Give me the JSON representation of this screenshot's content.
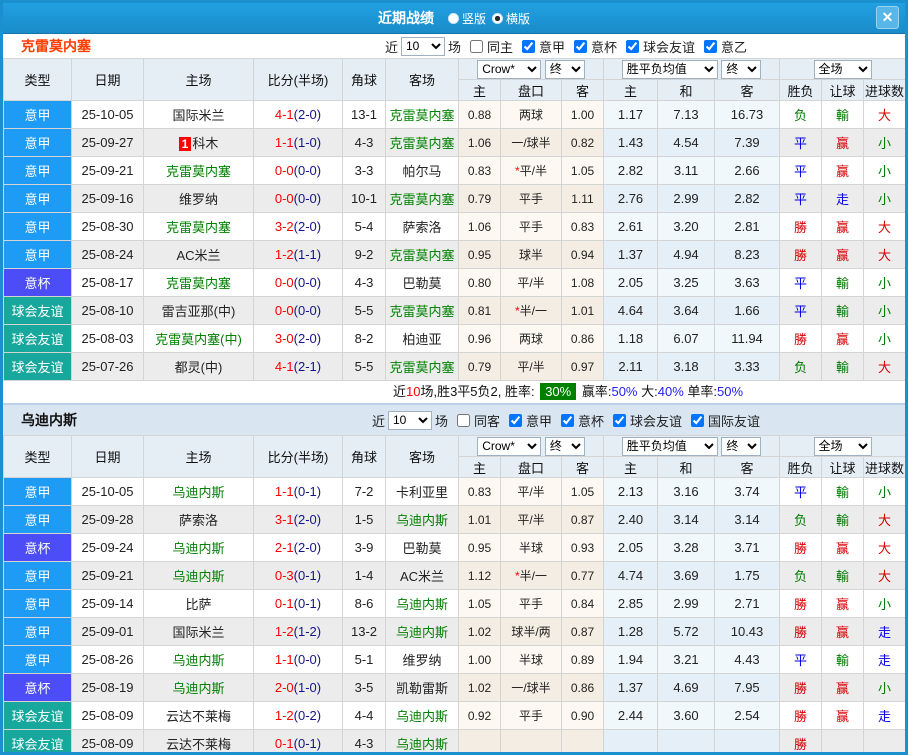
{
  "title_bar": {
    "title": "近期战绩",
    "view_options": [
      {
        "label": "竖版",
        "selected": false
      },
      {
        "label": "横版",
        "selected": true
      }
    ],
    "close_label": "✕"
  },
  "columns": {
    "type": "类型",
    "date": "日期",
    "home": "主场",
    "score": "比分(半场)",
    "corner": "角球",
    "away": "客场",
    "odds_home": "主",
    "odds_handicap": "盘口",
    "odds_away": "客",
    "avg_home": "主",
    "avg_draw": "和",
    "avg_away": "客",
    "result": "胜负",
    "handicap_result": "让球",
    "goals": "进球数",
    "odds_source_select": "Crow*",
    "odds_final_select": "终",
    "avg_select": "胜平负均值",
    "avg_final_select": "终",
    "scope_select": "全场"
  },
  "league_colors": {
    "意甲": "#1e9bf5",
    "意杯": "#4d4df7",
    "球会友谊": "#18a79c"
  },
  "result_colors": {
    "red": "#d60000",
    "green": "#007a00",
    "blue": "#0000e6"
  },
  "sections": [
    {
      "team": "克雷莫内塞",
      "filter": {
        "near": "近",
        "count": "10",
        "unit": "场",
        "same": "同主",
        "same_checked": false,
        "leagues": [
          {
            "label": "意甲",
            "checked": true
          },
          {
            "label": "意杯",
            "checked": true
          },
          {
            "label": "球会友谊",
            "checked": true
          },
          {
            "label": "意乙",
            "checked": true
          }
        ]
      },
      "rows": [
        {
          "league": "意甲",
          "date": "25-10-05",
          "home": "国际米兰",
          "home_green": false,
          "home_badge": "",
          "score": "4-1",
          "half": "(2-0)",
          "corner": "13-1",
          "away": "克雷莫内塞",
          "away_green": true,
          "odds": [
            "0.88",
            "两球",
            "1.00"
          ],
          "odds_star": false,
          "avg": [
            "1.17",
            "7.13",
            "16.73"
          ],
          "results": [
            {
              "t": "负",
              "c": "green"
            },
            {
              "t": "輸",
              "c": "green"
            },
            {
              "t": "大",
              "c": "red"
            }
          ]
        },
        {
          "league": "意甲",
          "date": "25-09-27",
          "home": "科木",
          "home_green": false,
          "home_badge": "1",
          "score": "1-1",
          "half": "(1-0)",
          "corner": "4-3",
          "away": "克雷莫内塞",
          "away_green": true,
          "odds": [
            "1.06",
            "一/球半",
            "0.82"
          ],
          "odds_star": false,
          "avg": [
            "1.43",
            "4.54",
            "7.39"
          ],
          "results": [
            {
              "t": "平",
              "c": "blue"
            },
            {
              "t": "赢",
              "c": "red"
            },
            {
              "t": "小",
              "c": "green"
            }
          ]
        },
        {
          "league": "意甲",
          "date": "25-09-21",
          "home": "克雷莫内塞",
          "home_green": true,
          "home_badge": "",
          "score": "0-0",
          "half": "(0-0)",
          "corner": "3-3",
          "away": "帕尔马",
          "away_green": false,
          "odds": [
            "0.83",
            "平/半",
            "1.05"
          ],
          "odds_star": true,
          "avg": [
            "2.82",
            "3.11",
            "2.66"
          ],
          "results": [
            {
              "t": "平",
              "c": "blue"
            },
            {
              "t": "赢",
              "c": "red"
            },
            {
              "t": "小",
              "c": "green"
            }
          ]
        },
        {
          "league": "意甲",
          "date": "25-09-16",
          "home": "维罗纳",
          "home_green": false,
          "home_badge": "",
          "score": "0-0",
          "half": "(0-0)",
          "corner": "10-1",
          "away": "克雷莫内塞",
          "away_green": true,
          "odds": [
            "0.79",
            "平手",
            "1.11"
          ],
          "odds_star": false,
          "avg": [
            "2.76",
            "2.99",
            "2.82"
          ],
          "results": [
            {
              "t": "平",
              "c": "blue"
            },
            {
              "t": "走",
              "c": "blue"
            },
            {
              "t": "小",
              "c": "green"
            }
          ]
        },
        {
          "league": "意甲",
          "date": "25-08-30",
          "home": "克雷莫内塞",
          "home_green": true,
          "home_badge": "",
          "score": "3-2",
          "half": "(2-0)",
          "corner": "5-4",
          "away": "萨索洛",
          "away_green": false,
          "odds": [
            "1.06",
            "平手",
            "0.83"
          ],
          "odds_star": false,
          "avg": [
            "2.61",
            "3.20",
            "2.81"
          ],
          "results": [
            {
              "t": "勝",
              "c": "red"
            },
            {
              "t": "赢",
              "c": "red"
            },
            {
              "t": "大",
              "c": "red"
            }
          ]
        },
        {
          "league": "意甲",
          "date": "25-08-24",
          "home": "AC米兰",
          "home_green": false,
          "home_badge": "",
          "score": "1-2",
          "half": "(1-1)",
          "corner": "9-2",
          "away": "克雷莫内塞",
          "away_green": true,
          "odds": [
            "0.95",
            "球半",
            "0.94"
          ],
          "odds_star": false,
          "avg": [
            "1.37",
            "4.94",
            "8.23"
          ],
          "results": [
            {
              "t": "勝",
              "c": "red"
            },
            {
              "t": "赢",
              "c": "red"
            },
            {
              "t": "大",
              "c": "red"
            }
          ]
        },
        {
          "league": "意杯",
          "date": "25-08-17",
          "home": "克雷莫内塞",
          "home_green": true,
          "home_badge": "",
          "score": "0-0",
          "half": "(0-0)",
          "corner": "4-3",
          "away": "巴勒莫",
          "away_green": false,
          "odds": [
            "0.80",
            "平/半",
            "1.08"
          ],
          "odds_star": false,
          "avg": [
            "2.05",
            "3.25",
            "3.63"
          ],
          "results": [
            {
              "t": "平",
              "c": "blue"
            },
            {
              "t": "輸",
              "c": "green"
            },
            {
              "t": "小",
              "c": "green"
            }
          ]
        },
        {
          "league": "球会友谊",
          "date": "25-08-10",
          "home": "雷吉亚那(中)",
          "home_green": false,
          "home_badge": "",
          "score": "0-0",
          "half": "(0-0)",
          "corner": "5-5",
          "away": "克雷莫内塞",
          "away_green": true,
          "odds": [
            "0.81",
            "半/一",
            "1.01"
          ],
          "odds_star": true,
          "avg": [
            "4.64",
            "3.64",
            "1.66"
          ],
          "results": [
            {
              "t": "平",
              "c": "blue"
            },
            {
              "t": "輸",
              "c": "green"
            },
            {
              "t": "小",
              "c": "green"
            }
          ]
        },
        {
          "league": "球会友谊",
          "date": "25-08-03",
          "home": "克雷莫内塞(中)",
          "home_green": true,
          "home_badge": "",
          "score": "3-0",
          "half": "(2-0)",
          "corner": "8-2",
          "away": "柏迪亚",
          "away_green": false,
          "odds": [
            "0.96",
            "两球",
            "0.86"
          ],
          "odds_star": false,
          "avg": [
            "1.18",
            "6.07",
            "11.94"
          ],
          "results": [
            {
              "t": "勝",
              "c": "red"
            },
            {
              "t": "赢",
              "c": "red"
            },
            {
              "t": "小",
              "c": "green"
            }
          ]
        },
        {
          "league": "球会友谊",
          "date": "25-07-26",
          "home": "都灵(中)",
          "home_green": false,
          "home_badge": "",
          "score": "4-1",
          "half": "(2-1)",
          "corner": "5-5",
          "away": "克雷莫内塞",
          "away_green": true,
          "odds": [
            "0.79",
            "平/半",
            "0.97"
          ],
          "odds_star": false,
          "avg": [
            "2.11",
            "3.18",
            "3.33"
          ],
          "results": [
            {
              "t": "负",
              "c": "green"
            },
            {
              "t": "輸",
              "c": "green"
            },
            {
              "t": "大",
              "c": "red"
            }
          ]
        }
      ],
      "summary": [
        {
          "text": "近",
          "style": "plain"
        },
        {
          "text": "10",
          "style": "red"
        },
        {
          "text": "场,胜3平5负2, 胜率: ",
          "style": "plain"
        },
        {
          "text": "30%",
          "style": "badge"
        },
        {
          "text": " 赢率:",
          "style": "plain"
        },
        {
          "text": "50%",
          "style": "blue"
        },
        {
          "text": " 大:",
          "style": "plain"
        },
        {
          "text": "40%",
          "style": "blue"
        },
        {
          "text": " 单率:",
          "style": "plain"
        },
        {
          "text": "50%",
          "style": "blue"
        }
      ]
    },
    {
      "team": "乌迪内斯",
      "filter": {
        "near": "近",
        "count": "10",
        "unit": "场",
        "same": "同客",
        "same_checked": false,
        "leagues": [
          {
            "label": "意甲",
            "checked": true
          },
          {
            "label": "意杯",
            "checked": true
          },
          {
            "label": "球会友谊",
            "checked": true
          },
          {
            "label": "国际友谊",
            "checked": true
          }
        ]
      },
      "rows": [
        {
          "league": "意甲",
          "date": "25-10-05",
          "home": "乌迪内斯",
          "home_green": true,
          "home_badge": "",
          "score": "1-1",
          "half": "(0-1)",
          "corner": "7-2",
          "away": "卡利亚里",
          "away_green": false,
          "odds": [
            "0.83",
            "平/半",
            "1.05"
          ],
          "odds_star": false,
          "avg": [
            "2.13",
            "3.16",
            "3.74"
          ],
          "results": [
            {
              "t": "平",
              "c": "blue"
            },
            {
              "t": "輸",
              "c": "green"
            },
            {
              "t": "小",
              "c": "green"
            }
          ]
        },
        {
          "league": "意甲",
          "date": "25-09-28",
          "home": "萨索洛",
          "home_green": false,
          "home_badge": "",
          "score": "3-1",
          "half": "(2-0)",
          "corner": "1-5",
          "away": "乌迪内斯",
          "away_green": true,
          "odds": [
            "1.01",
            "平/半",
            "0.87"
          ],
          "odds_star": false,
          "avg": [
            "2.40",
            "3.14",
            "3.14"
          ],
          "results": [
            {
              "t": "负",
              "c": "green"
            },
            {
              "t": "輸",
              "c": "green"
            },
            {
              "t": "大",
              "c": "red"
            }
          ]
        },
        {
          "league": "意杯",
          "date": "25-09-24",
          "home": "乌迪内斯",
          "home_green": true,
          "home_badge": "",
          "score": "2-1",
          "half": "(2-0)",
          "corner": "3-9",
          "away": "巴勒莫",
          "away_green": false,
          "odds": [
            "0.95",
            "半球",
            "0.93"
          ],
          "odds_star": false,
          "avg": [
            "2.05",
            "3.28",
            "3.71"
          ],
          "results": [
            {
              "t": "勝",
              "c": "red"
            },
            {
              "t": "赢",
              "c": "red"
            },
            {
              "t": "大",
              "c": "red"
            }
          ]
        },
        {
          "league": "意甲",
          "date": "25-09-21",
          "home": "乌迪内斯",
          "home_green": true,
          "home_badge": "",
          "score": "0-3",
          "half": "(0-1)",
          "corner": "1-4",
          "away": "AC米兰",
          "away_green": false,
          "odds": [
            "1.12",
            "半/一",
            "0.77"
          ],
          "odds_star": true,
          "avg": [
            "4.74",
            "3.69",
            "1.75"
          ],
          "results": [
            {
              "t": "负",
              "c": "green"
            },
            {
              "t": "輸",
              "c": "green"
            },
            {
              "t": "大",
              "c": "red"
            }
          ]
        },
        {
          "league": "意甲",
          "date": "25-09-14",
          "home": "比萨",
          "home_green": false,
          "home_badge": "",
          "score": "0-1",
          "half": "(0-1)",
          "corner": "8-6",
          "away": "乌迪内斯",
          "away_green": true,
          "odds": [
            "1.05",
            "平手",
            "0.84"
          ],
          "odds_star": false,
          "avg": [
            "2.85",
            "2.99",
            "2.71"
          ],
          "results": [
            {
              "t": "勝",
              "c": "red"
            },
            {
              "t": "赢",
              "c": "red"
            },
            {
              "t": "小",
              "c": "green"
            }
          ]
        },
        {
          "league": "意甲",
          "date": "25-09-01",
          "home": "国际米兰",
          "home_green": false,
          "home_badge": "",
          "score": "1-2",
          "half": "(1-2)",
          "corner": "13-2",
          "away": "乌迪内斯",
          "away_green": true,
          "odds": [
            "1.02",
            "球半/两",
            "0.87"
          ],
          "odds_star": false,
          "avg": [
            "1.28",
            "5.72",
            "10.43"
          ],
          "results": [
            {
              "t": "勝",
              "c": "red"
            },
            {
              "t": "赢",
              "c": "red"
            },
            {
              "t": "走",
              "c": "blue"
            }
          ]
        },
        {
          "league": "意甲",
          "date": "25-08-26",
          "home": "乌迪内斯",
          "home_green": true,
          "home_badge": "",
          "score": "1-1",
          "half": "(0-0)",
          "corner": "5-1",
          "away": "维罗纳",
          "away_green": false,
          "odds": [
            "1.00",
            "半球",
            "0.89"
          ],
          "odds_star": false,
          "avg": [
            "1.94",
            "3.21",
            "4.43"
          ],
          "results": [
            {
              "t": "平",
              "c": "blue"
            },
            {
              "t": "輸",
              "c": "green"
            },
            {
              "t": "走",
              "c": "blue"
            }
          ]
        },
        {
          "league": "意杯",
          "date": "25-08-19",
          "home": "乌迪内斯",
          "home_green": true,
          "home_badge": "",
          "score": "2-0",
          "half": "(1-0)",
          "corner": "3-5",
          "away": "凯勒雷斯",
          "away_green": false,
          "odds": [
            "1.02",
            "一/球半",
            "0.86"
          ],
          "odds_star": false,
          "avg": [
            "1.37",
            "4.69",
            "7.95"
          ],
          "results": [
            {
              "t": "勝",
              "c": "red"
            },
            {
              "t": "赢",
              "c": "red"
            },
            {
              "t": "小",
              "c": "green"
            }
          ]
        },
        {
          "league": "球会友谊",
          "date": "25-08-09",
          "home": "云达不莱梅",
          "home_green": false,
          "home_badge": "",
          "score": "1-2",
          "half": "(0-2)",
          "corner": "4-4",
          "away": "乌迪内斯",
          "away_green": true,
          "odds": [
            "0.92",
            "平手",
            "0.90"
          ],
          "odds_star": false,
          "avg": [
            "2.44",
            "3.60",
            "2.54"
          ],
          "results": [
            {
              "t": "勝",
              "c": "red"
            },
            {
              "t": "赢",
              "c": "red"
            },
            {
              "t": "走",
              "c": "blue"
            }
          ]
        },
        {
          "league": "球会友谊",
          "date": "25-08-09",
          "home": "云达不莱梅",
          "home_green": false,
          "home_badge": "",
          "score": "0-1",
          "half": "(0-1)",
          "corner": "4-3",
          "away": "乌迪内斯",
          "away_green": true,
          "odds": [
            "",
            "",
            ""
          ],
          "odds_star": false,
          "avg": [
            "",
            "",
            ""
          ],
          "results": [
            {
              "t": "勝",
              "c": "red"
            },
            {
              "t": "",
              "c": ""
            },
            {
              "t": "",
              "c": ""
            }
          ]
        }
      ],
      "summary": []
    }
  ]
}
